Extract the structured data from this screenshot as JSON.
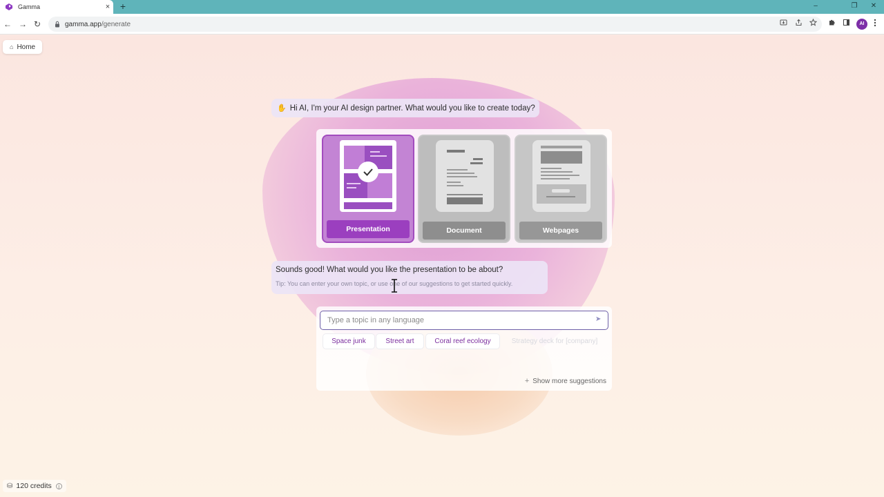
{
  "browser": {
    "tab_title": "Gamma",
    "tab_close": "×",
    "new_tab": "+",
    "url_host": "gamma.app",
    "url_path": "/generate",
    "profile_initials": "AI",
    "window_minimize": "–",
    "window_restore": "❐",
    "window_close": "✕",
    "nav_back": "←",
    "nav_forward": "→",
    "nav_reload": "↻"
  },
  "page": {
    "home_label": "Home",
    "greeting": "Hi AI, I'm your AI design partner. What would you like to create today?",
    "cards": [
      {
        "label": "Presentation",
        "selected": true
      },
      {
        "label": "Document",
        "selected": false
      },
      {
        "label": "Webpages",
        "selected": false
      }
    ],
    "prompt_question": "Sounds good! What would you like the presentation to be about?",
    "prompt_tip": "Tip: You can enter your own topic, or use one of our suggestions to get started quickly.",
    "input_placeholder": "Type a topic in any language",
    "suggestions": [
      "Space junk",
      "Street art",
      "Coral reef ecology",
      "Strategy deck for [company]"
    ],
    "show_more": "Show more suggestions",
    "credits": "120 credits"
  },
  "colors": {
    "accent": "#9b3fbf",
    "tabstrip": "#5fb4ba",
    "chip_text": "#7b2e9e"
  },
  "icons": {
    "home": "home-icon",
    "wave": "waving-hand-icon",
    "check": "check-icon",
    "send": "send-icon",
    "plus": "plus-icon",
    "credits": "coins-icon",
    "info": "info-icon"
  }
}
